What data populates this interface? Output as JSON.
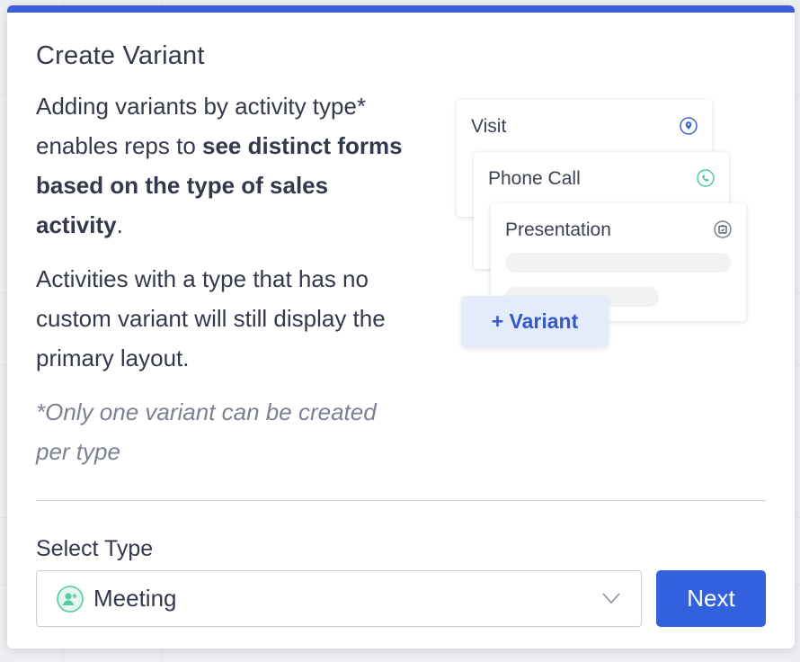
{
  "dialog": {
    "title": "Create Variant",
    "desc1_text1": "Adding variants by activity type* enables reps to ",
    "desc1_bold": "see distinct forms based on the type of sales activity",
    "desc1_text2": ".",
    "desc2": "Activities with a type that has no custom variant will still display the primary layout.",
    "note": "*Only one variant can be created per type"
  },
  "illustration": {
    "cards": [
      {
        "label": "Visit",
        "icon": "location-pin-icon"
      },
      {
        "label": "Phone Call",
        "icon": "phone-icon"
      },
      {
        "label": "Presentation",
        "icon": "presentation-icon"
      }
    ],
    "variant_button": "+ Variant"
  },
  "select": {
    "label": "Select Type",
    "value": "Meeting",
    "icon": "meeting-user-icon"
  },
  "next_button": "Next",
  "colors": {
    "accent": "#3360dd",
    "topbar": "#3b5fd9",
    "variant_bg": "#e4ebfb",
    "text": "#33394a",
    "muted": "#7b8190"
  }
}
